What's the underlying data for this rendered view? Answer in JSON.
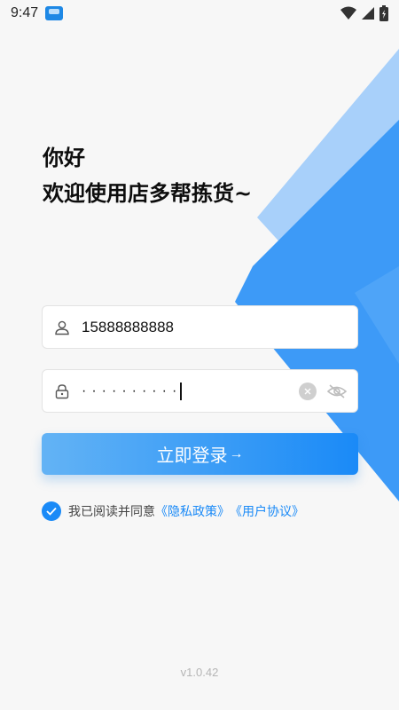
{
  "status_bar": {
    "time": "9:47",
    "icons": [
      "notification-app-icon",
      "wifi-icon",
      "signal-icon",
      "battery-icon"
    ]
  },
  "greeting": {
    "line1": "你好",
    "line2": "欢迎使用店多帮拣货~"
  },
  "phone_field": {
    "icon": "user-icon",
    "value": "15888888888"
  },
  "password_field": {
    "icon": "lock-icon",
    "masked_value": "··········",
    "clear_icon": "clear-icon",
    "visibility_icon": "eye-off-icon"
  },
  "login_button": {
    "label": "立即登录",
    "arrow": "→"
  },
  "agreement": {
    "checked": true,
    "prefix": "我已阅读并同意",
    "privacy_link": "《隐私政策》",
    "user_agreement_link": "《用户协议》"
  },
  "version": "v1.0.42",
  "colors": {
    "accent": "#1a8af7",
    "background": "#f7f7f7",
    "deco_light": "#a8d0fa",
    "deco_dark": "#3d9af7"
  }
}
